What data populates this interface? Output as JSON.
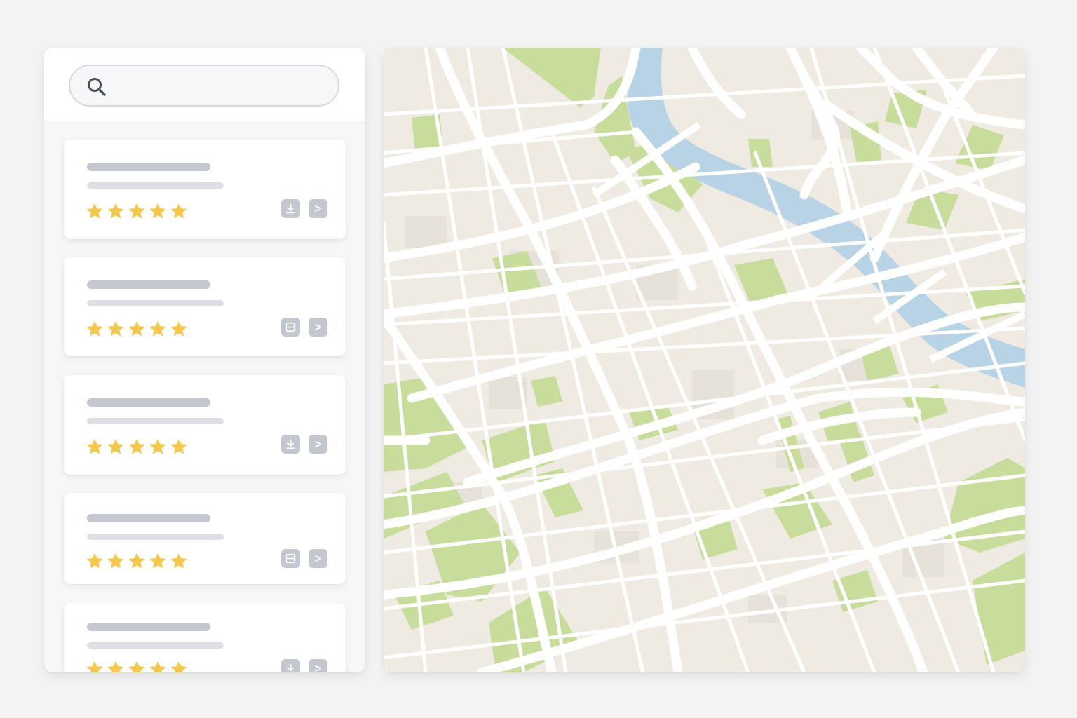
{
  "search": {
    "placeholder": "",
    "value": "",
    "icon": "magnifier-icon"
  },
  "results": [
    {
      "rating": 5,
      "actions": [
        "download-icon",
        "next-icon"
      ]
    },
    {
      "rating": 5,
      "actions": [
        "details-icon",
        "next-icon"
      ]
    },
    {
      "rating": 5,
      "actions": [
        "download-icon",
        "next-icon"
      ]
    },
    {
      "rating": 5,
      "actions": [
        "details-icon",
        "next-icon"
      ]
    },
    {
      "rating": 5,
      "actions": [
        "download-icon",
        "next-icon"
      ]
    }
  ],
  "colors": {
    "star": "#f4c74e",
    "park": "#c8dc9c",
    "water": "#b9d3e6",
    "land": "#efebe2",
    "road": "#ffffff",
    "button": "#c3c7cf"
  }
}
